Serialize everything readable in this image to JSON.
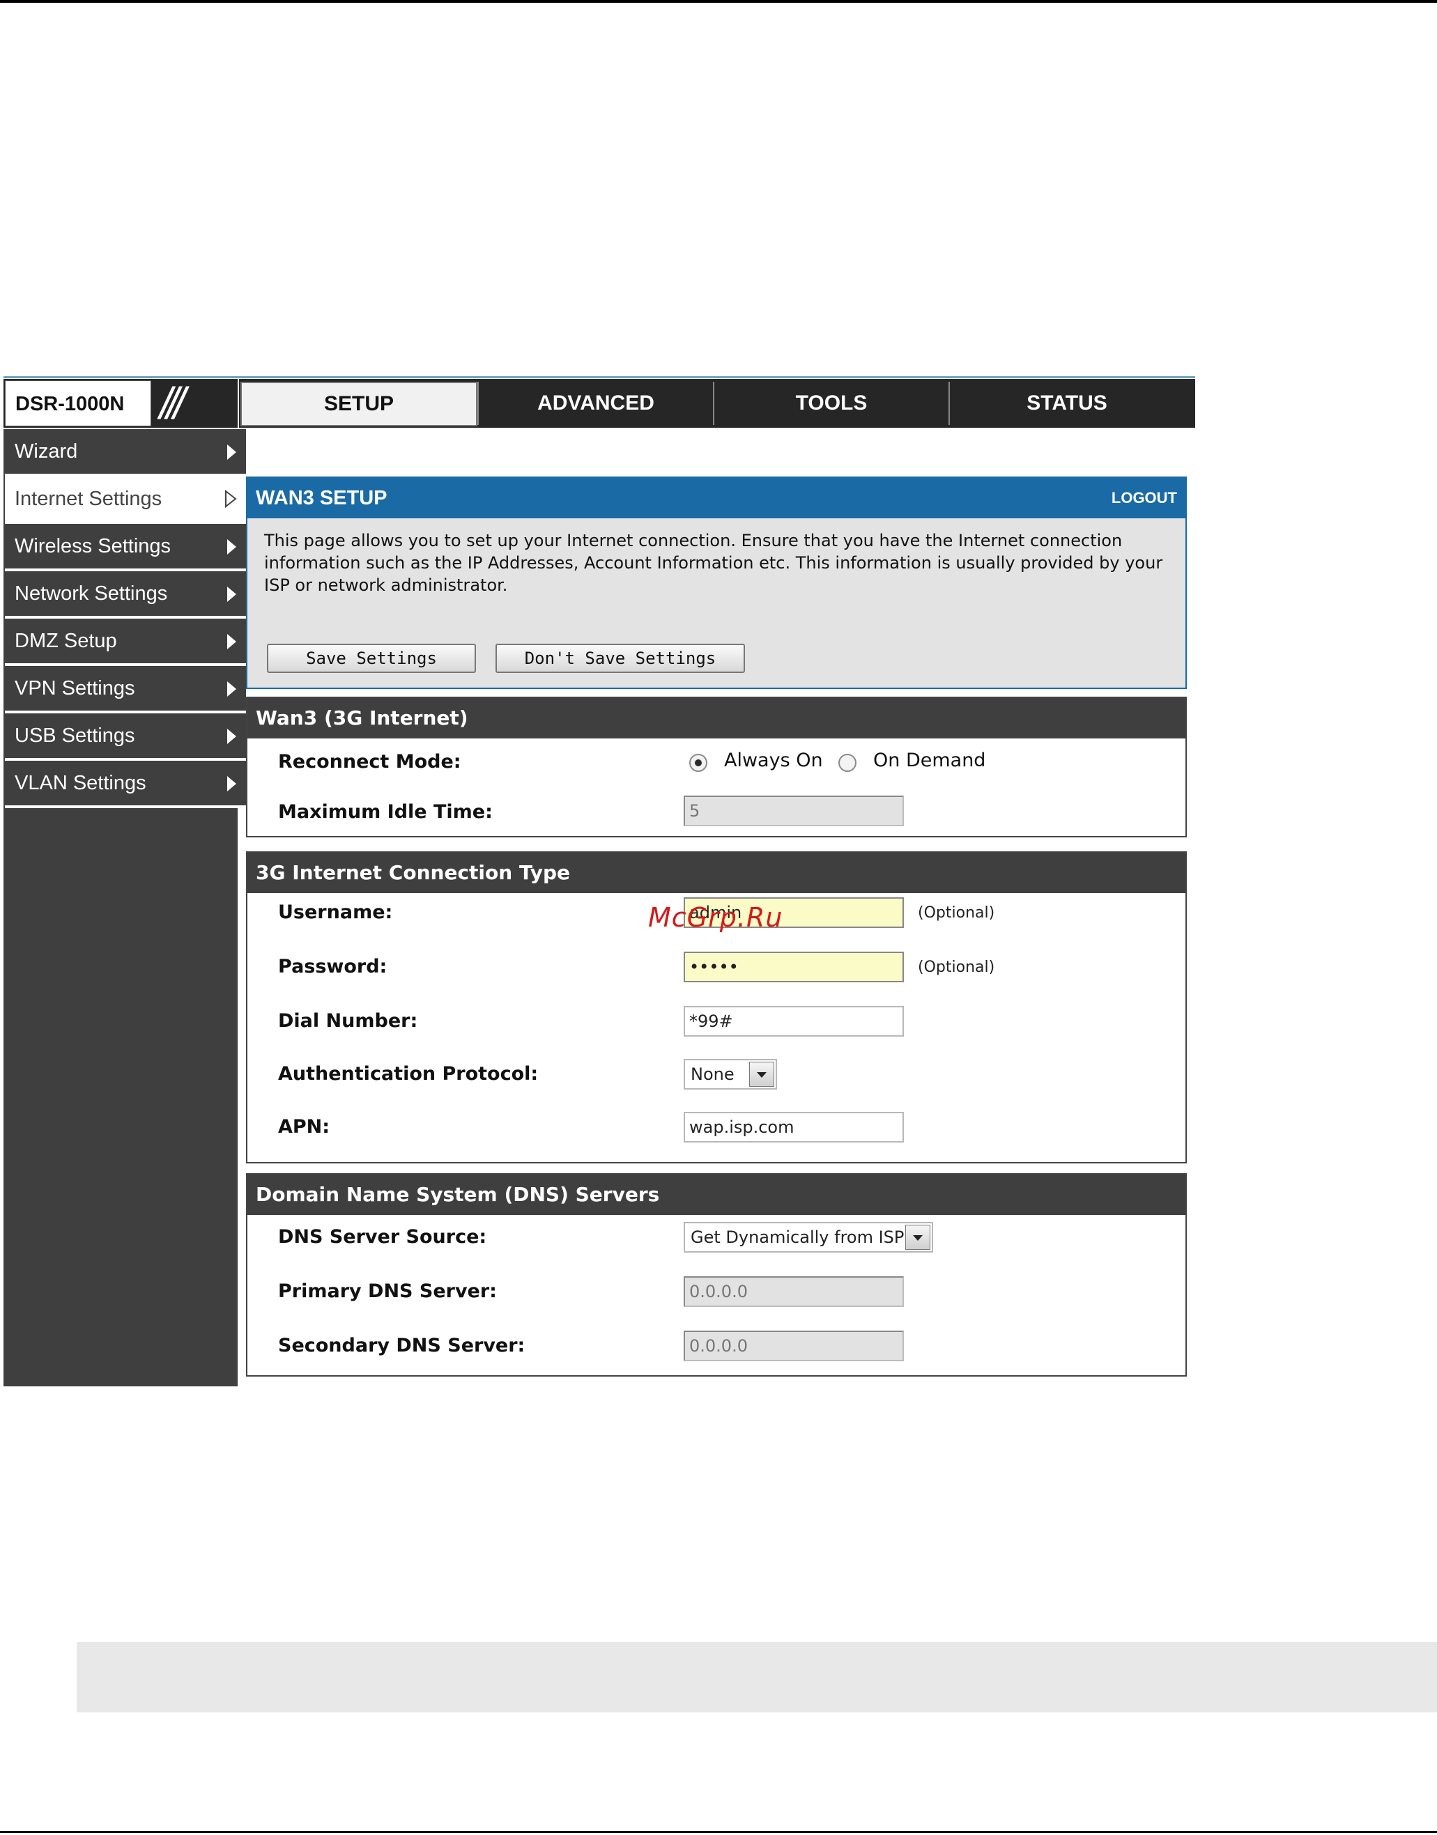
{
  "header": {
    "brand": "DSR-1000N",
    "brand_slashes": "///",
    "tabs": [
      {
        "label": "SETUP",
        "active": true
      },
      {
        "label": "ADVANCED",
        "active": false
      },
      {
        "label": "TOOLS",
        "active": false
      },
      {
        "label": "STATUS",
        "active": false
      }
    ]
  },
  "sidebar": {
    "items": [
      {
        "label": "Wizard",
        "active": false
      },
      {
        "label": "Internet Settings",
        "active": true
      },
      {
        "label": "Wireless Settings",
        "active": false
      },
      {
        "label": "Network Settings",
        "active": false
      },
      {
        "label": "DMZ Setup",
        "active": false
      },
      {
        "label": "VPN Settings",
        "active": false
      },
      {
        "label": "USB Settings",
        "active": false
      },
      {
        "label": "VLAN Settings",
        "active": false
      }
    ]
  },
  "intro": {
    "title": "WAN3 SETUP",
    "logout": "LOGOUT",
    "text": "This page allows you to set up your Internet connection. Ensure that you have the Internet connection information such as the IP Addresses, Account Information etc. This information is usually provided by your ISP or network administrator.",
    "save_label": "Save Settings",
    "dont_save_label": "Don't Save Settings"
  },
  "wan3": {
    "title": "Wan3 (3G Internet)",
    "reconnect_label": "Reconnect Mode:",
    "reconnect_options": [
      "Always On",
      "On Demand"
    ],
    "reconnect_selected": "Always On",
    "idle_label": "Maximum Idle Time:",
    "idle_value": "5"
  },
  "connection": {
    "title": "3G Internet Connection Type",
    "username_label": "Username:",
    "username_value": "admin",
    "password_label": "Password:",
    "password_value": "•••••",
    "optional_label": "(Optional)",
    "dial_label": "Dial Number:",
    "dial_value": "*99#",
    "auth_label": "Authentication Protocol:",
    "auth_value": "None",
    "apn_label": "APN:",
    "apn_value": "wap.isp.com"
  },
  "dns": {
    "title": "Domain Name System (DNS) Servers",
    "source_label": "DNS Server Source:",
    "source_value": "Get Dynamically from ISP",
    "primary_label": "Primary DNS Server:",
    "primary_value": "0.0.0.0",
    "secondary_label": "Secondary DNS Server:",
    "secondary_value": "0.0.0.0"
  },
  "watermark": "McGrp.Ru",
  "colors": {
    "accent_blue": "#1a6aa6",
    "dark_gray": "#3f3f3f",
    "input_yellow": "#fbfbc8"
  }
}
